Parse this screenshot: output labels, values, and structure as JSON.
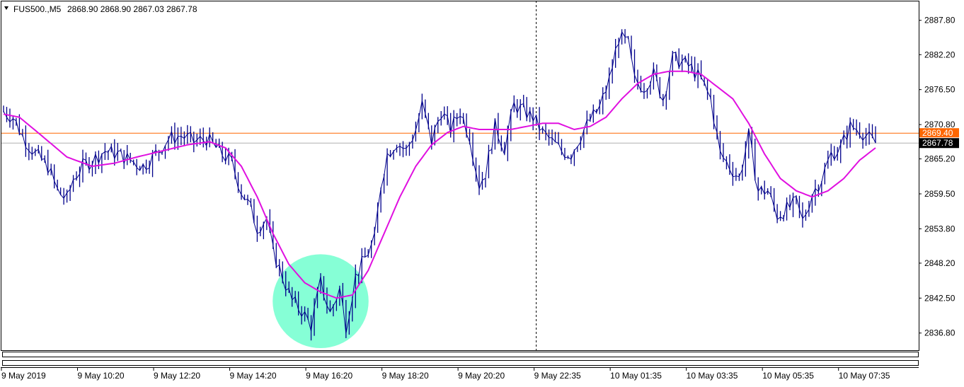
{
  "header": {
    "symbol_label": "FUS500.,M5",
    "ohlc_values": "2868.90 2868.90 2867.03 2867.78"
  },
  "colors": {
    "background": "#ffffff",
    "price_line": "#00008b",
    "moving_average": "#e010e0",
    "horizontal_level": "#ff6600",
    "highlight_ellipse": "#7fffd4",
    "axis": "#000000",
    "price_badge_bg": "#000000",
    "price_badge_text": "#ffffff"
  },
  "chart_data": {
    "type": "line",
    "title": "",
    "xlabel": "",
    "ylabel": "",
    "ylim": [
      2834.0,
      2891.0
    ],
    "grid": false,
    "y_ticks": [
      2887.8,
      2882.2,
      2876.5,
      2870.8,
      2865.2,
      2859.5,
      2853.8,
      2848.2,
      2842.5,
      2836.8
    ],
    "y_tick_labels": [
      "2887.80",
      "2882.20",
      "2876.50",
      "2870.80",
      "2865.20",
      "2859.50",
      "2853.80",
      "2848.20",
      "2842.50",
      "2836.80"
    ],
    "x_tick_labels": [
      "9 May 2019",
      "9 May 10:20",
      "9 May 12:20",
      "9 May 14:20",
      "9 May 16:20",
      "9 May 18:20",
      "9 May 20:20",
      "9 May 22:35",
      "10 May 01:35",
      "10 May 03:35",
      "10 May 05:35",
      "10 May 07:35"
    ],
    "x_tick_index": [
      0,
      24,
      48,
      72,
      96,
      120,
      144,
      168,
      192,
      216,
      240,
      264
    ],
    "bar_count": 276,
    "price_key": [
      [
        0,
        2873
      ],
      [
        3,
        2872
      ],
      [
        6,
        2869
      ],
      [
        10,
        2866
      ],
      [
        14,
        2864
      ],
      [
        17,
        2860
      ],
      [
        20,
        2858.5
      ],
      [
        22,
        2862
      ],
      [
        25,
        2864
      ],
      [
        28,
        2865
      ],
      [
        32,
        2866.5
      ],
      [
        36,
        2866
      ],
      [
        40,
        2865
      ],
      [
        44,
        2864
      ],
      [
        48,
        2866
      ],
      [
        52,
        2868.5
      ],
      [
        56,
        2869
      ],
      [
        60,
        2868
      ],
      [
        64,
        2868.5
      ],
      [
        68,
        2866.5
      ],
      [
        72,
        2864.5
      ],
      [
        75,
        2860
      ],
      [
        78,
        2857
      ],
      [
        80,
        2854
      ],
      [
        83,
        2855.5
      ],
      [
        85,
        2850
      ],
      [
        88,
        2846
      ],
      [
        91,
        2842
      ],
      [
        94,
        2840.5
      ],
      [
        97,
        2838
      ],
      [
        100,
        2845
      ],
      [
        103,
        2840
      ],
      [
        106,
        2844
      ],
      [
        108,
        2838
      ],
      [
        111,
        2846
      ],
      [
        114,
        2849
      ],
      [
        117,
        2852
      ],
      [
        119,
        2861
      ],
      [
        121,
        2866
      ],
      [
        124,
        2868
      ],
      [
        127,
        2866.5
      ],
      [
        130,
        2870
      ],
      [
        132,
        2874
      ],
      [
        135,
        2868
      ],
      [
        138,
        2873
      ],
      [
        141,
        2870
      ],
      [
        144,
        2873
      ],
      [
        147,
        2869
      ],
      [
        150,
        2861
      ],
      [
        152,
        2863
      ],
      [
        155,
        2870.5
      ],
      [
        158,
        2867
      ],
      [
        161,
        2874
      ],
      [
        164,
        2873
      ],
      [
        167,
        2872
      ],
      [
        170,
        2869.5
      ],
      [
        173,
        2868
      ],
      [
        176,
        2866.5
      ],
      [
        179,
        2866
      ],
      [
        182,
        2869
      ],
      [
        185,
        2871.5
      ],
      [
        188,
        2873.5
      ],
      [
        191,
        2878
      ],
      [
        194,
        2885
      ],
      [
        197,
        2884
      ],
      [
        199,
        2878
      ],
      [
        202,
        2877
      ],
      [
        205,
        2879
      ],
      [
        208,
        2875
      ],
      [
        211,
        2881.5
      ],
      [
        214,
        2881
      ],
      [
        217,
        2880
      ],
      [
        220,
        2878
      ],
      [
        223,
        2875
      ],
      [
        226,
        2866
      ],
      [
        229,
        2864
      ],
      [
        232,
        2862
      ],
      [
        235,
        2869
      ],
      [
        238,
        2860
      ],
      [
        241,
        2860
      ],
      [
        244,
        2856
      ],
      [
        247,
        2857
      ],
      [
        250,
        2858
      ],
      [
        252,
        2855
      ],
      [
        255,
        2859.5
      ],
      [
        258,
        2862
      ],
      [
        261,
        2866
      ],
      [
        264,
        2867
      ],
      [
        267,
        2870.5
      ],
      [
        270,
        2870
      ],
      [
        273,
        2868.5
      ],
      [
        275,
        2867.78
      ]
    ],
    "moving_average_key": [
      [
        0,
        2872.5
      ],
      [
        5,
        2872
      ],
      [
        12,
        2869
      ],
      [
        20,
        2865.5
      ],
      [
        28,
        2864
      ],
      [
        35,
        2864.5
      ],
      [
        42,
        2865.5
      ],
      [
        50,
        2866.5
      ],
      [
        58,
        2867.5
      ],
      [
        65,
        2868
      ],
      [
        70,
        2867
      ],
      [
        75,
        2864
      ],
      [
        80,
        2859
      ],
      [
        85,
        2853
      ],
      [
        90,
        2848
      ],
      [
        95,
        2845
      ],
      [
        100,
        2843.5
      ],
      [
        105,
        2842.5
      ],
      [
        110,
        2843
      ],
      [
        115,
        2847
      ],
      [
        120,
        2853
      ],
      [
        125,
        2859
      ],
      [
        130,
        2864
      ],
      [
        135,
        2867.5
      ],
      [
        140,
        2869.5
      ],
      [
        145,
        2870.5
      ],
      [
        150,
        2870
      ],
      [
        155,
        2870
      ],
      [
        160,
        2870
      ],
      [
        165,
        2870.5
      ],
      [
        170,
        2871
      ],
      [
        175,
        2871
      ],
      [
        180,
        2870
      ],
      [
        185,
        2870.5
      ],
      [
        190,
        2872
      ],
      [
        195,
        2875
      ],
      [
        200,
        2877.5
      ],
      [
        205,
        2879
      ],
      [
        210,
        2879.5
      ],
      [
        215,
        2879.5
      ],
      [
        220,
        2879
      ],
      [
        225,
        2877
      ],
      [
        230,
        2875
      ],
      [
        235,
        2871
      ],
      [
        240,
        2866
      ],
      [
        245,
        2862
      ],
      [
        250,
        2860
      ],
      [
        255,
        2859
      ],
      [
        260,
        2860
      ],
      [
        265,
        2862
      ],
      [
        270,
        2865
      ],
      [
        275,
        2867
      ]
    ],
    "horizontal_levels": [
      2869.4,
      2867.78
    ],
    "level_labels": [
      "2869.40",
      "2867.78"
    ],
    "vertical_marker_index": 168,
    "highlight": {
      "index_from": 88,
      "index_to": 112,
      "price_low": 2835.5,
      "price_high": 2848.5
    }
  }
}
